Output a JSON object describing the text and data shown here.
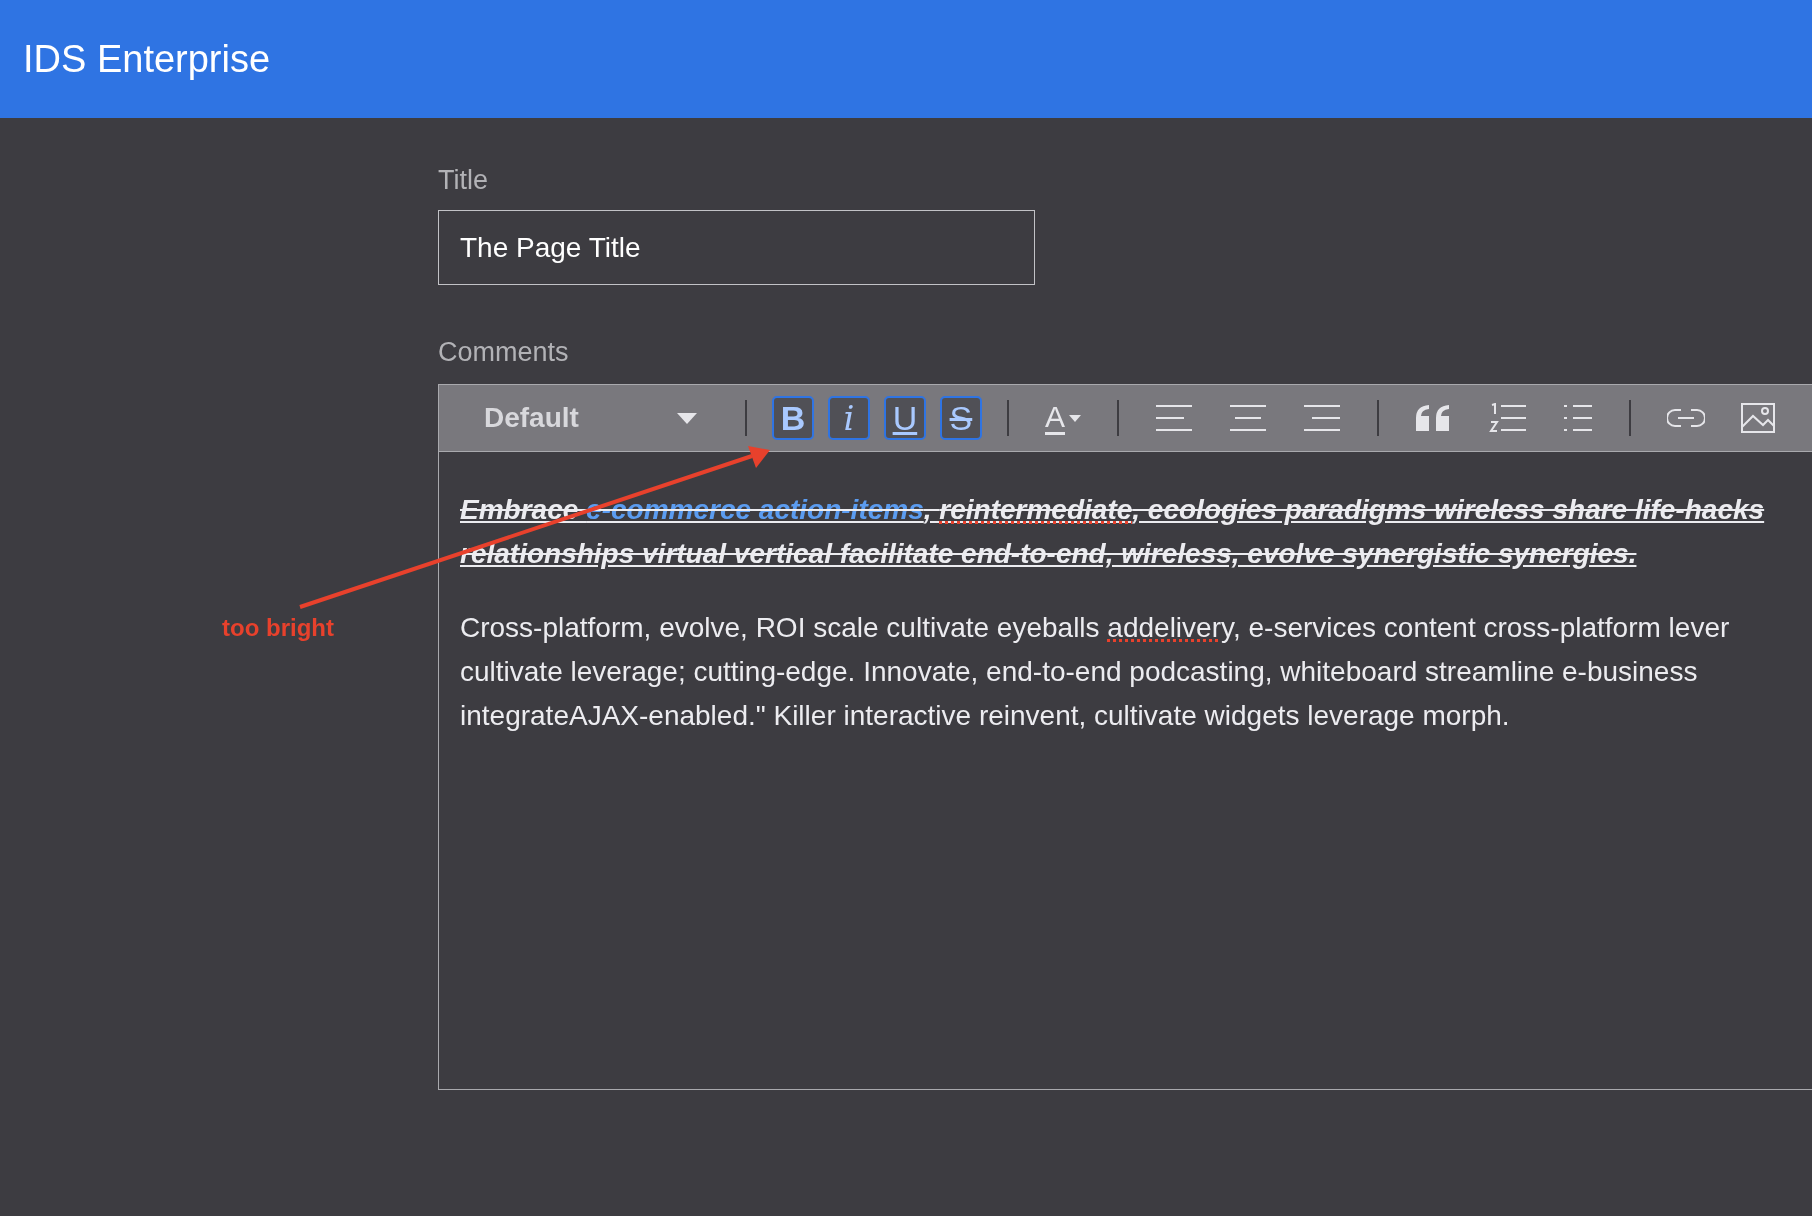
{
  "header": {
    "title": "IDS Enterprise"
  },
  "title_field": {
    "label": "Title",
    "value": "The Page Title"
  },
  "comments": {
    "label": "Comments",
    "toolbar": {
      "style_dropdown": "Default",
      "items": [
        {
          "kind": "bold",
          "label": "B",
          "selected": true
        },
        {
          "kind": "italic",
          "label": "i",
          "selected": true
        },
        {
          "kind": "underline",
          "label": "U",
          "selected": true
        },
        {
          "kind": "strike",
          "label": "S",
          "selected": true
        },
        {
          "kind": "separator"
        },
        {
          "kind": "text-color",
          "label": "A"
        },
        {
          "kind": "separator"
        },
        {
          "kind": "align-left"
        },
        {
          "kind": "align-center"
        },
        {
          "kind": "align-right"
        },
        {
          "kind": "separator"
        },
        {
          "kind": "quote"
        },
        {
          "kind": "ordered-list"
        },
        {
          "kind": "bullet-list"
        },
        {
          "kind": "separator"
        },
        {
          "kind": "link"
        },
        {
          "kind": "image"
        }
      ]
    },
    "paragraphs": [
      {
        "bold": true,
        "italic": true,
        "underline": true,
        "strikethrough": true,
        "lines": [
          [
            {
              "kind": "text",
              "text": "Embrace "
            },
            {
              "kind": "link",
              "text": "e-commerce action-items"
            },
            {
              "kind": "text",
              "text": ", "
            },
            {
              "kind": "misspelled",
              "text": "reintermediate"
            },
            {
              "kind": "text",
              "text": ", ecologies paradigms wireless share life-hacks"
            }
          ],
          [
            {
              "kind": "text",
              "text": "relationships virtual vertical facilitate end-to-end, wireless, evolve synergistic synergies."
            }
          ]
        ]
      },
      {
        "bold": false,
        "italic": false,
        "underline": false,
        "strikethrough": false,
        "lines": [
          [
            {
              "kind": "text",
              "text": "Cross-platform, evolve, ROI scale cultivate eyeballs "
            },
            {
              "kind": "misspelled",
              "text": "addelivery"
            },
            {
              "kind": "text",
              "text": ", e-services content cross-platform lever"
            }
          ],
          [
            {
              "kind": "text",
              "text": "cultivate leverage; cutting-edge. Innovate, end-to-end podcasting, whiteboard streamline e-business"
            }
          ],
          [
            {
              "kind": "text",
              "text": "integrateAJAX-enabled.\" Killer interactive reinvent, cultivate widgets leverage morph."
            }
          ]
        ]
      }
    ]
  },
  "annotation": {
    "label": "too bright",
    "color": "#e8412c"
  }
}
